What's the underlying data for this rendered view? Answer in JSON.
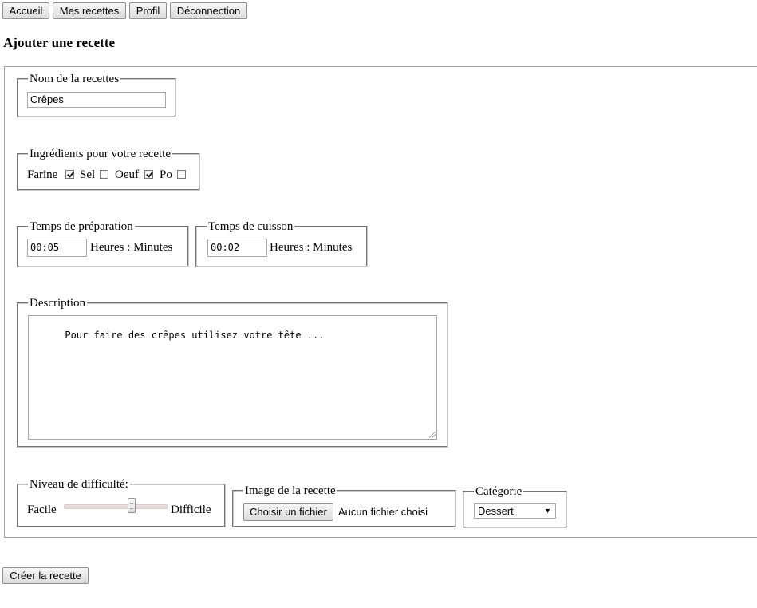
{
  "nav": {
    "home": "Accueil",
    "my_recipes": "Mes recettes",
    "profile": "Profil",
    "logout": "Déconnection"
  },
  "page_title": "Ajouter une recette",
  "recipe_name": {
    "legend": "Nom de la recettes",
    "value": "Crêpes"
  },
  "ingredients": {
    "legend": "Ingrédients pour votre recette",
    "items": [
      {
        "label": "Farine",
        "checked": true
      },
      {
        "label": "Sel",
        "checked": false
      },
      {
        "label": "Oeuf",
        "checked": true
      },
      {
        "label": "Po",
        "checked": false
      }
    ]
  },
  "prep_time": {
    "legend": "Temps de préparation",
    "value": "00:05",
    "unit": "Heures : Minutes"
  },
  "cook_time": {
    "legend": "Temps de cuisson",
    "value": "00:02",
    "unit": "Heures : Minutes"
  },
  "description": {
    "legend": "Description",
    "value": "Pour faire des crêpes utilisez votre tête ..."
  },
  "difficulty": {
    "legend": "Niveau de difficulté:",
    "min_label": "Facile",
    "max_label": "Difficile",
    "level": 0.68
  },
  "image": {
    "legend": "Image de la recette",
    "button": "Choisir un fichier",
    "status": "Aucun fichier choisi"
  },
  "category": {
    "legend": "Catégorie",
    "selected": "Dessert"
  },
  "submit": "Créer la recette"
}
